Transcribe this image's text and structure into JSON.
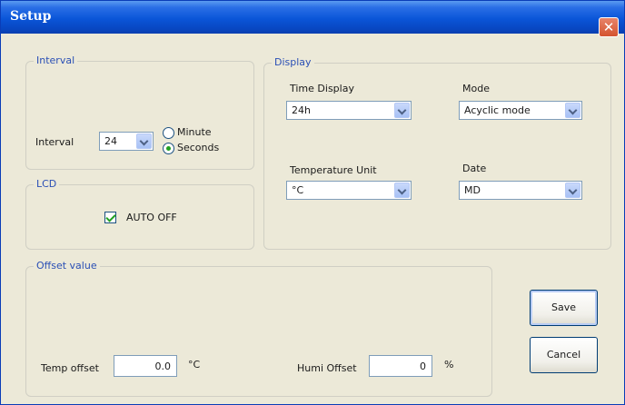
{
  "window": {
    "title": "Setup",
    "close_glyph": "✕"
  },
  "interval_group": {
    "title": "Interval",
    "label": "Interval",
    "value": "24",
    "options": [
      {
        "label": "Minute",
        "selected": false
      },
      {
        "label": "Seconds",
        "selected": true
      }
    ]
  },
  "lcd_group": {
    "title": "LCD",
    "auto_off_label": "AUTO OFF",
    "auto_off_checked": true
  },
  "display_group": {
    "title": "Display",
    "time_display_label": "Time Display",
    "time_display_value": "24h",
    "mode_label": "Mode",
    "mode_value": "Acyclic mode",
    "temp_unit_label": "Temperature Unit",
    "temp_unit_value": "°C",
    "date_label": "Date",
    "date_value": "MD"
  },
  "offset_group": {
    "title": "Offset value",
    "temp_label": "Temp offset",
    "temp_value": "0.0",
    "temp_unit": "°C",
    "humi_label": "Humi Offset",
    "humi_value": "0",
    "humi_unit": "%"
  },
  "buttons": {
    "save": "Save",
    "cancel": "Cancel"
  },
  "colors": {
    "titlebar": "#0a55d8",
    "group_title": "#2a4fb5",
    "background": "#ece9d8"
  },
  "icons": {
    "close": "close-icon",
    "dropdown": "chevron-down-icon"
  }
}
